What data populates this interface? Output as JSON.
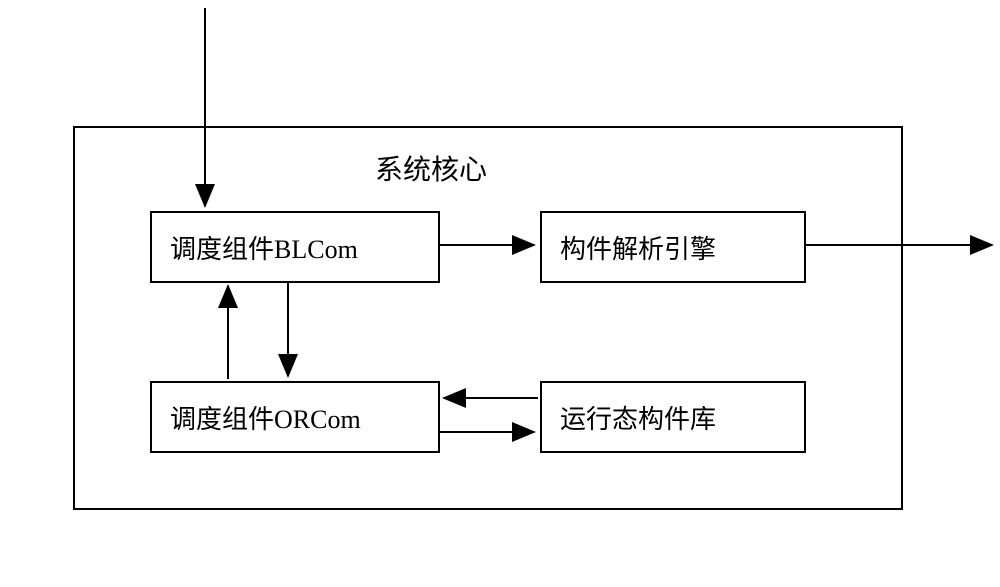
{
  "diagram": {
    "title": "系统核心",
    "nodes": {
      "blcom": "调度组件BLCom",
      "engine": "构件解析引擎",
      "orcom": "调度组件ORCom",
      "lib": "运行态构件库"
    }
  }
}
